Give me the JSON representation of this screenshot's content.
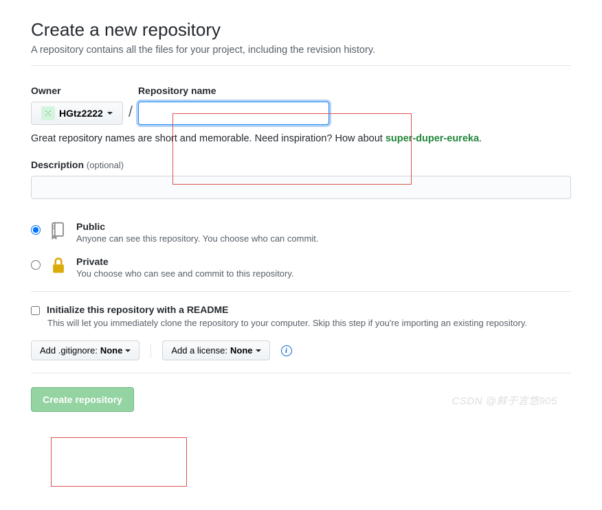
{
  "header": {
    "title": "Create a new repository",
    "subtitle": "A repository contains all the files for your project, including the revision history."
  },
  "owner": {
    "label": "Owner",
    "username": "HGtz2222"
  },
  "repoName": {
    "label": "Repository name",
    "value": ""
  },
  "hint": {
    "prefix": "Great repository names are short and memorable. Need inspiration? How about ",
    "suggestion": "super-duper-eureka",
    "suffix": "."
  },
  "description": {
    "label": "Description",
    "optional": "(optional)",
    "value": ""
  },
  "visibility": {
    "public": {
      "title": "Public",
      "desc": "Anyone can see this repository. You choose who can commit."
    },
    "private": {
      "title": "Private",
      "desc": "You choose who can see and commit to this repository."
    }
  },
  "readme": {
    "title": "Initialize this repository with a README",
    "desc": "This will let you immediately clone the repository to your computer. Skip this step if you're importing an existing repository."
  },
  "dropdowns": {
    "gitignore": {
      "label": "Add .gitignore: ",
      "value": "None"
    },
    "license": {
      "label": "Add a license: ",
      "value": "None"
    }
  },
  "submit": {
    "label": "Create repository"
  },
  "watermark": "CSDN @鲜于言悠905"
}
